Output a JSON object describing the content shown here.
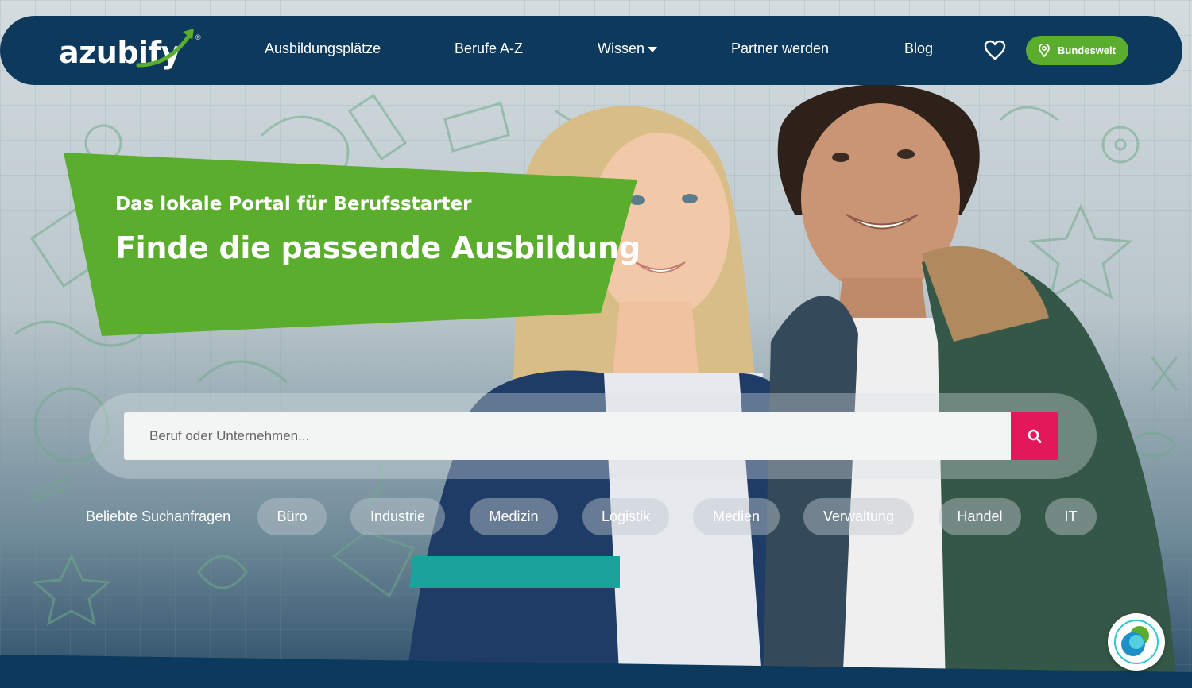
{
  "brand": {
    "logo_text": "azubify",
    "registered": "®",
    "navy": "#0d3a5c",
    "green": "#5aad2d",
    "pink": "#e3185b"
  },
  "nav": {
    "links": [
      {
        "label": "Ausbildungsplätze"
      },
      {
        "label": "Berufe A-Z"
      },
      {
        "label": "Wissen",
        "has_dropdown": true
      },
      {
        "label": "Partner werden"
      },
      {
        "label": "Blog"
      }
    ],
    "favorites_icon": "heart-icon",
    "location_label": "Bundesweit",
    "location_icon": "map-pin-icon"
  },
  "hero": {
    "subtitle": "Das lokale Portal für Berufsstarter",
    "title": "Finde die passende Ausbildung"
  },
  "search": {
    "placeholder": "Beruf oder Unternehmen...",
    "value": "",
    "button_icon": "search-icon"
  },
  "popular": {
    "label": "Beliebte Suchanfragen",
    "chips": [
      "Büro",
      "Industrie",
      "Medizin",
      "Logistik",
      "Medien",
      "Verwaltung",
      "Handel",
      "IT"
    ]
  },
  "chat": {
    "icon": "chat-assistant-icon"
  }
}
